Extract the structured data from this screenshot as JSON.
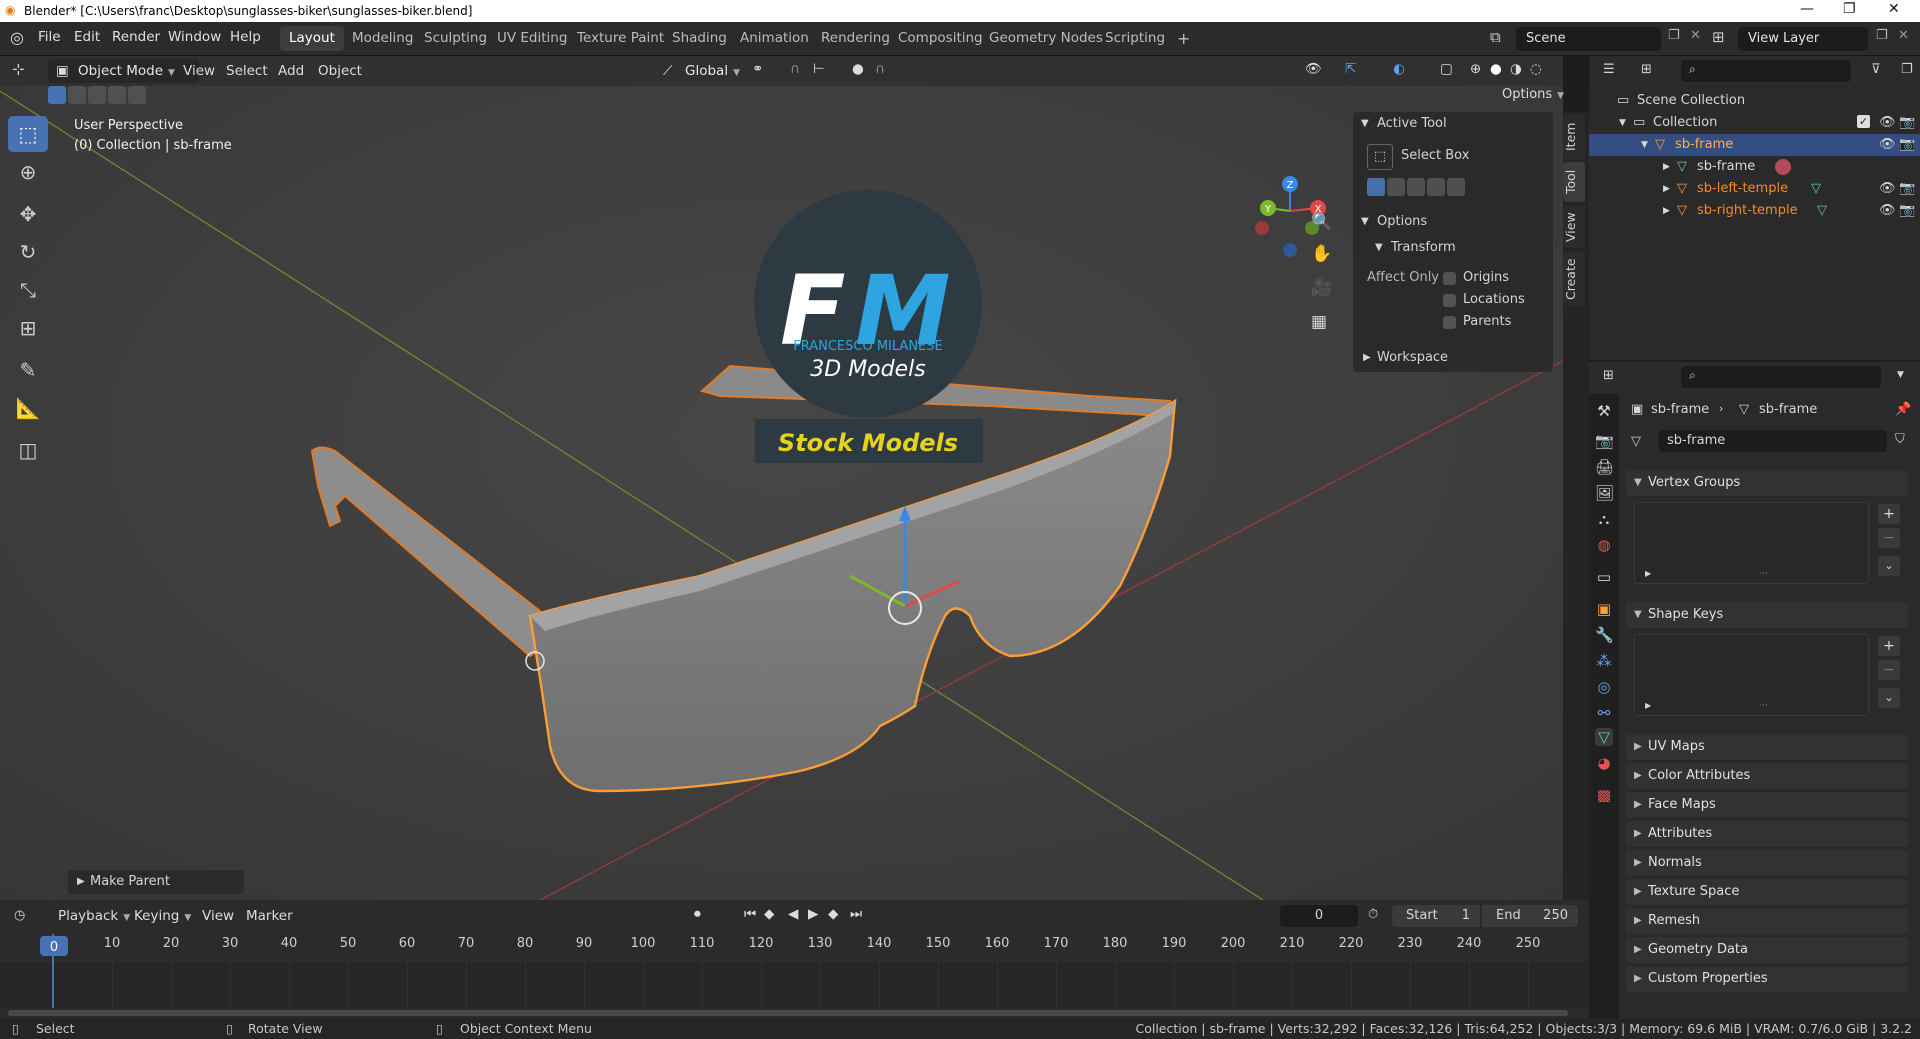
{
  "window": {
    "title": "Blender* [C:\\Users\\franc\\Desktop\\sunglasses-biker\\sunglasses-biker.blend]"
  },
  "menus": [
    "File",
    "Edit",
    "Render",
    "Window",
    "Help"
  ],
  "workspaces": [
    "Layout",
    "Modeling",
    "Sculpting",
    "UV Editing",
    "Texture Paint",
    "Shading",
    "Animation",
    "Rendering",
    "Compositing",
    "Geometry Nodes",
    "Scripting"
  ],
  "scene": {
    "name": "Scene",
    "view_layer": "View Layer"
  },
  "viewport": {
    "mode": "Object Mode",
    "menus": [
      "View",
      "Select",
      "Add",
      "Object"
    ],
    "orientation": "Global",
    "options_label": "Options",
    "overlay_title": "User Perspective",
    "overlay_sub": "(0) Collection | sb-frame",
    "last_op": "Make Parent",
    "watermark": {
      "initials_f": "F",
      "initials_m": "M",
      "author": "FRANCESCO MILANESE",
      "line2": "3D Models",
      "banner": "Stock Models"
    },
    "gizmo_axes": [
      "Z",
      "Y",
      "X"
    ]
  },
  "npanel": {
    "tabs": [
      "Item",
      "Tool",
      "View",
      "Create"
    ],
    "active_tool_header": "Active Tool",
    "tool_name": "Select Box",
    "options_header": "Options",
    "transform_header": "Transform",
    "affect_only": "Affect Only",
    "checks": [
      "Origins",
      "Locations",
      "Parents"
    ],
    "workspace_header": "Workspace"
  },
  "outliner": {
    "root": "Scene Collection",
    "collection": "Collection",
    "items": [
      {
        "label": "sb-frame",
        "selected": true
      },
      {
        "label": "sb-frame",
        "selected": false
      },
      {
        "label": "sb-left-temple",
        "selected": false
      },
      {
        "label": "sb-right-temple",
        "selected": false
      }
    ]
  },
  "properties": {
    "breadcrumb_object": "sb-frame",
    "breadcrumb_data": "sb-frame",
    "mesh_name": "sb-frame",
    "panels_open": [
      "Vertex Groups",
      "Shape Keys"
    ],
    "panels_closed": [
      "UV Maps",
      "Color Attributes",
      "Face Maps",
      "Attributes",
      "Normals",
      "Texture Space",
      "Remesh",
      "Geometry Data",
      "Custom Properties"
    ]
  },
  "timeline": {
    "menus": [
      "Playback",
      "Keying",
      "View",
      "Marker"
    ],
    "current_frame": "0",
    "start_label": "Start",
    "start": "1",
    "end_label": "End",
    "end": "250",
    "ticks": [
      "0",
      "10",
      "20",
      "30",
      "40",
      "50",
      "60",
      "70",
      "80",
      "90",
      "100",
      "110",
      "120",
      "130",
      "140",
      "150",
      "160",
      "170",
      "180",
      "190",
      "200",
      "210",
      "220",
      "230",
      "240",
      "250"
    ]
  },
  "statusbar": {
    "select": "Select",
    "rotate": "Rotate View",
    "context": "Object Context Menu",
    "stats": "Collection | sb-frame | Verts:32,292 | Faces:32,126 | Tris:64,252 | Objects:3/3 | Memory: 69.6 MiB | VRAM: 0.7/6.0 GiB | 3.2.2"
  },
  "colors": {
    "accent": "#4772b3",
    "selection": "#f28c28",
    "active_orange": "#ff9c36",
    "header": "#303030"
  }
}
